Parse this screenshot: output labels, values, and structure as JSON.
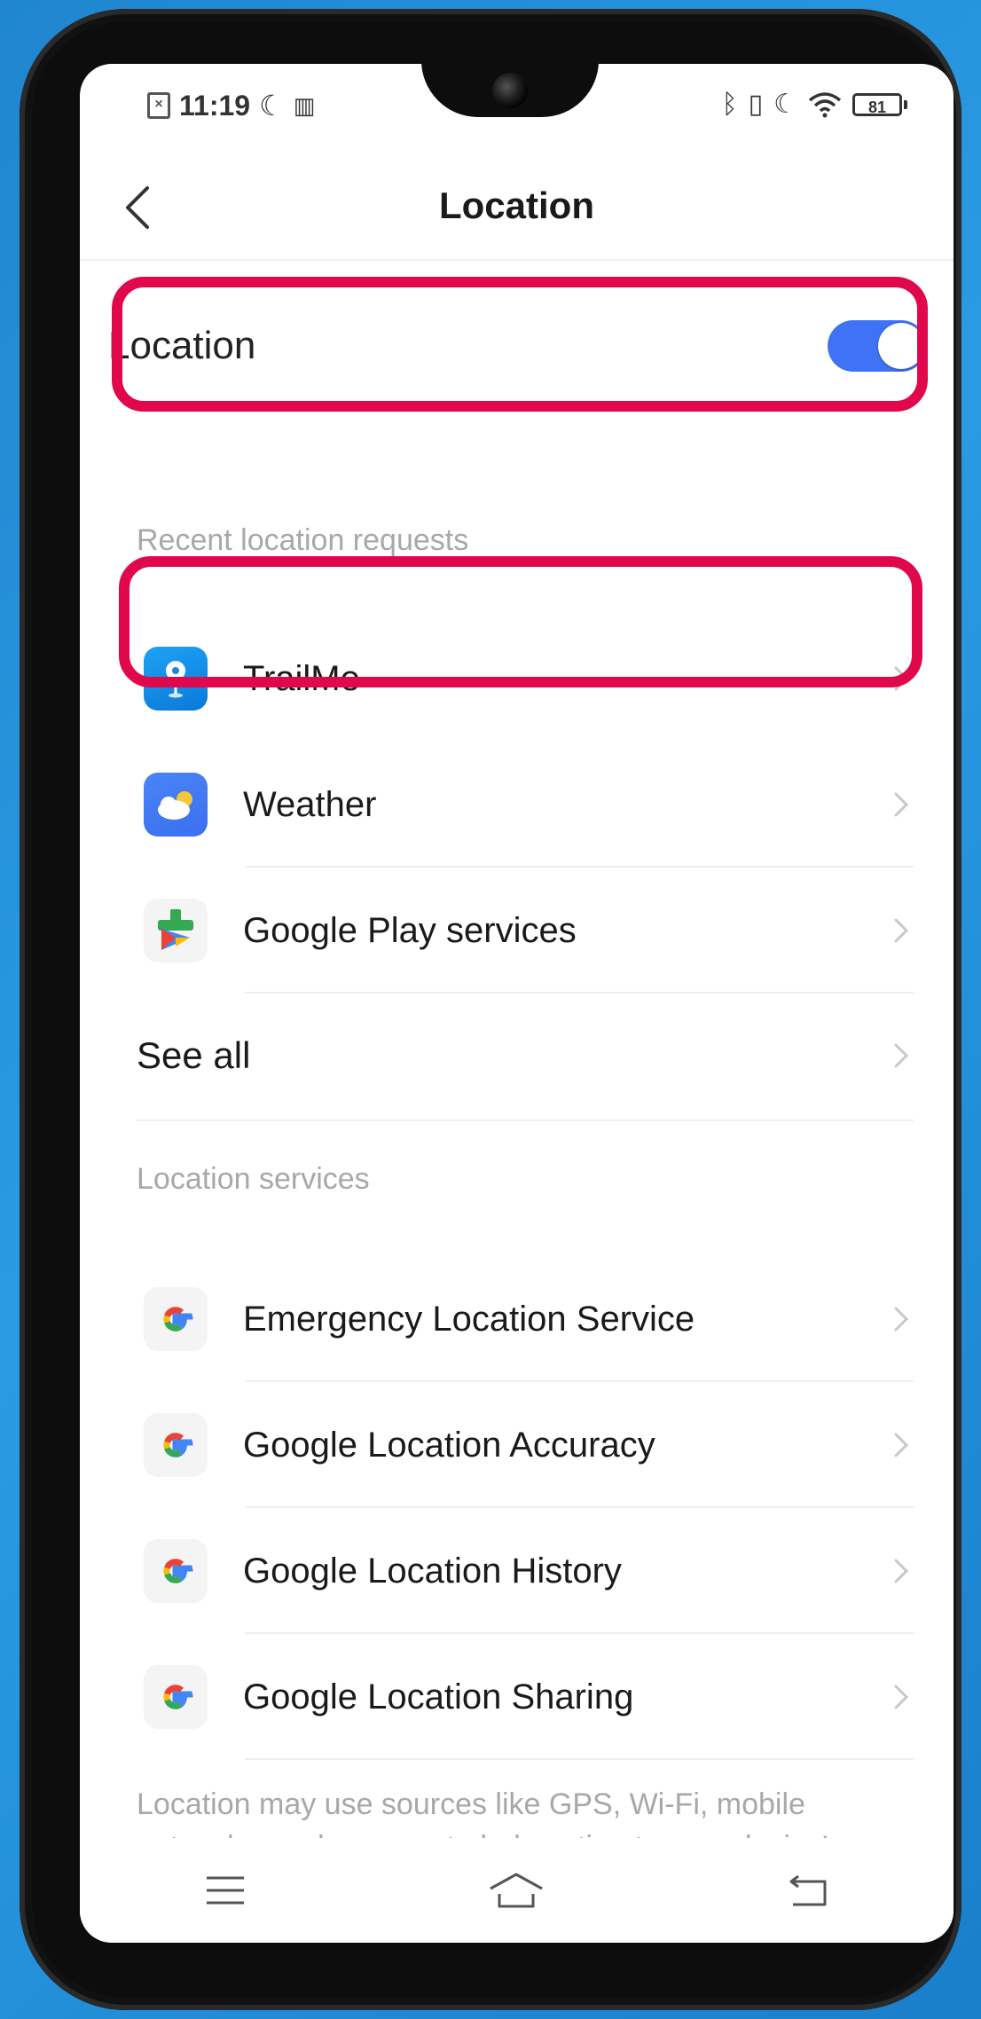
{
  "status_bar": {
    "time": "11:19",
    "battery": "81"
  },
  "header": {
    "title": "Location"
  },
  "location_toggle": {
    "label": "Location",
    "enabled": true
  },
  "recent": {
    "section_label": "Recent location requests",
    "apps": [
      {
        "label": "TrailMe",
        "icon": "trailme-pin-icon"
      },
      {
        "label": "Weather",
        "icon": "weather-cloud-icon"
      },
      {
        "label": "Google Play services",
        "icon": "google-play-services-icon"
      }
    ],
    "see_all": "See all"
  },
  "services": {
    "section_label": "Location services",
    "items": [
      {
        "label": "Emergency Location Service",
        "icon": "google-g-icon"
      },
      {
        "label": "Google Location Accuracy",
        "icon": "google-g-icon"
      },
      {
        "label": "Google Location History",
        "icon": "google-g-icon"
      },
      {
        "label": "Google Location Sharing",
        "icon": "google-g-icon"
      }
    ]
  },
  "footer": {
    "text": "Location may use sources like GPS, Wi-Fi, mobile networks, and sensors to help estimate your device's"
  },
  "colors": {
    "accent": "#3f72f5",
    "highlight": "#e0074d"
  }
}
